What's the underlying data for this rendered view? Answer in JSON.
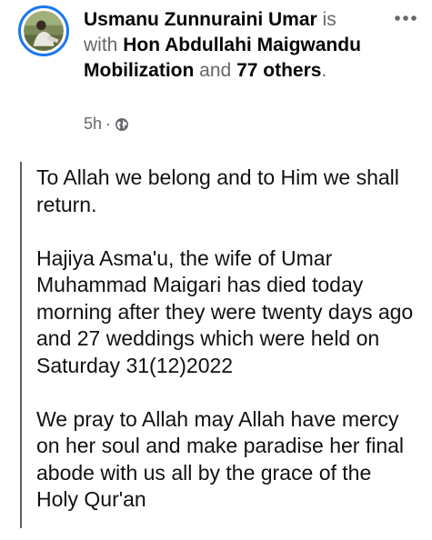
{
  "post": {
    "author": "Usmanu Zunnuraini Umar",
    "is_with": "is with",
    "tagged": "Hon Abdullahi Maigwandu Mobilization",
    "and": "and",
    "others": "77 others",
    "period": ".",
    "time": "5h",
    "separator": "·",
    "privacy_icon": "globe-icon",
    "more_icon": "more-dots-icon",
    "paragraphs": [
      "To Allah we belong and to Him we shall return.",
      "Hajiya Asma'u, the wife of Umar Muhammad Maigari has died today morning after they were twenty days ago and 27 weddings which were held on Saturday 31(12)2022",
      "We pray to Allah may Allah have mercy on her soul and make paradise her final abode with us all by the grace of the Holy Qur'an"
    ]
  },
  "colors": {
    "accent": "#1877f2",
    "secondary_text": "#65676b",
    "primary_text": "#050505",
    "rule": "#5f5f5f"
  }
}
